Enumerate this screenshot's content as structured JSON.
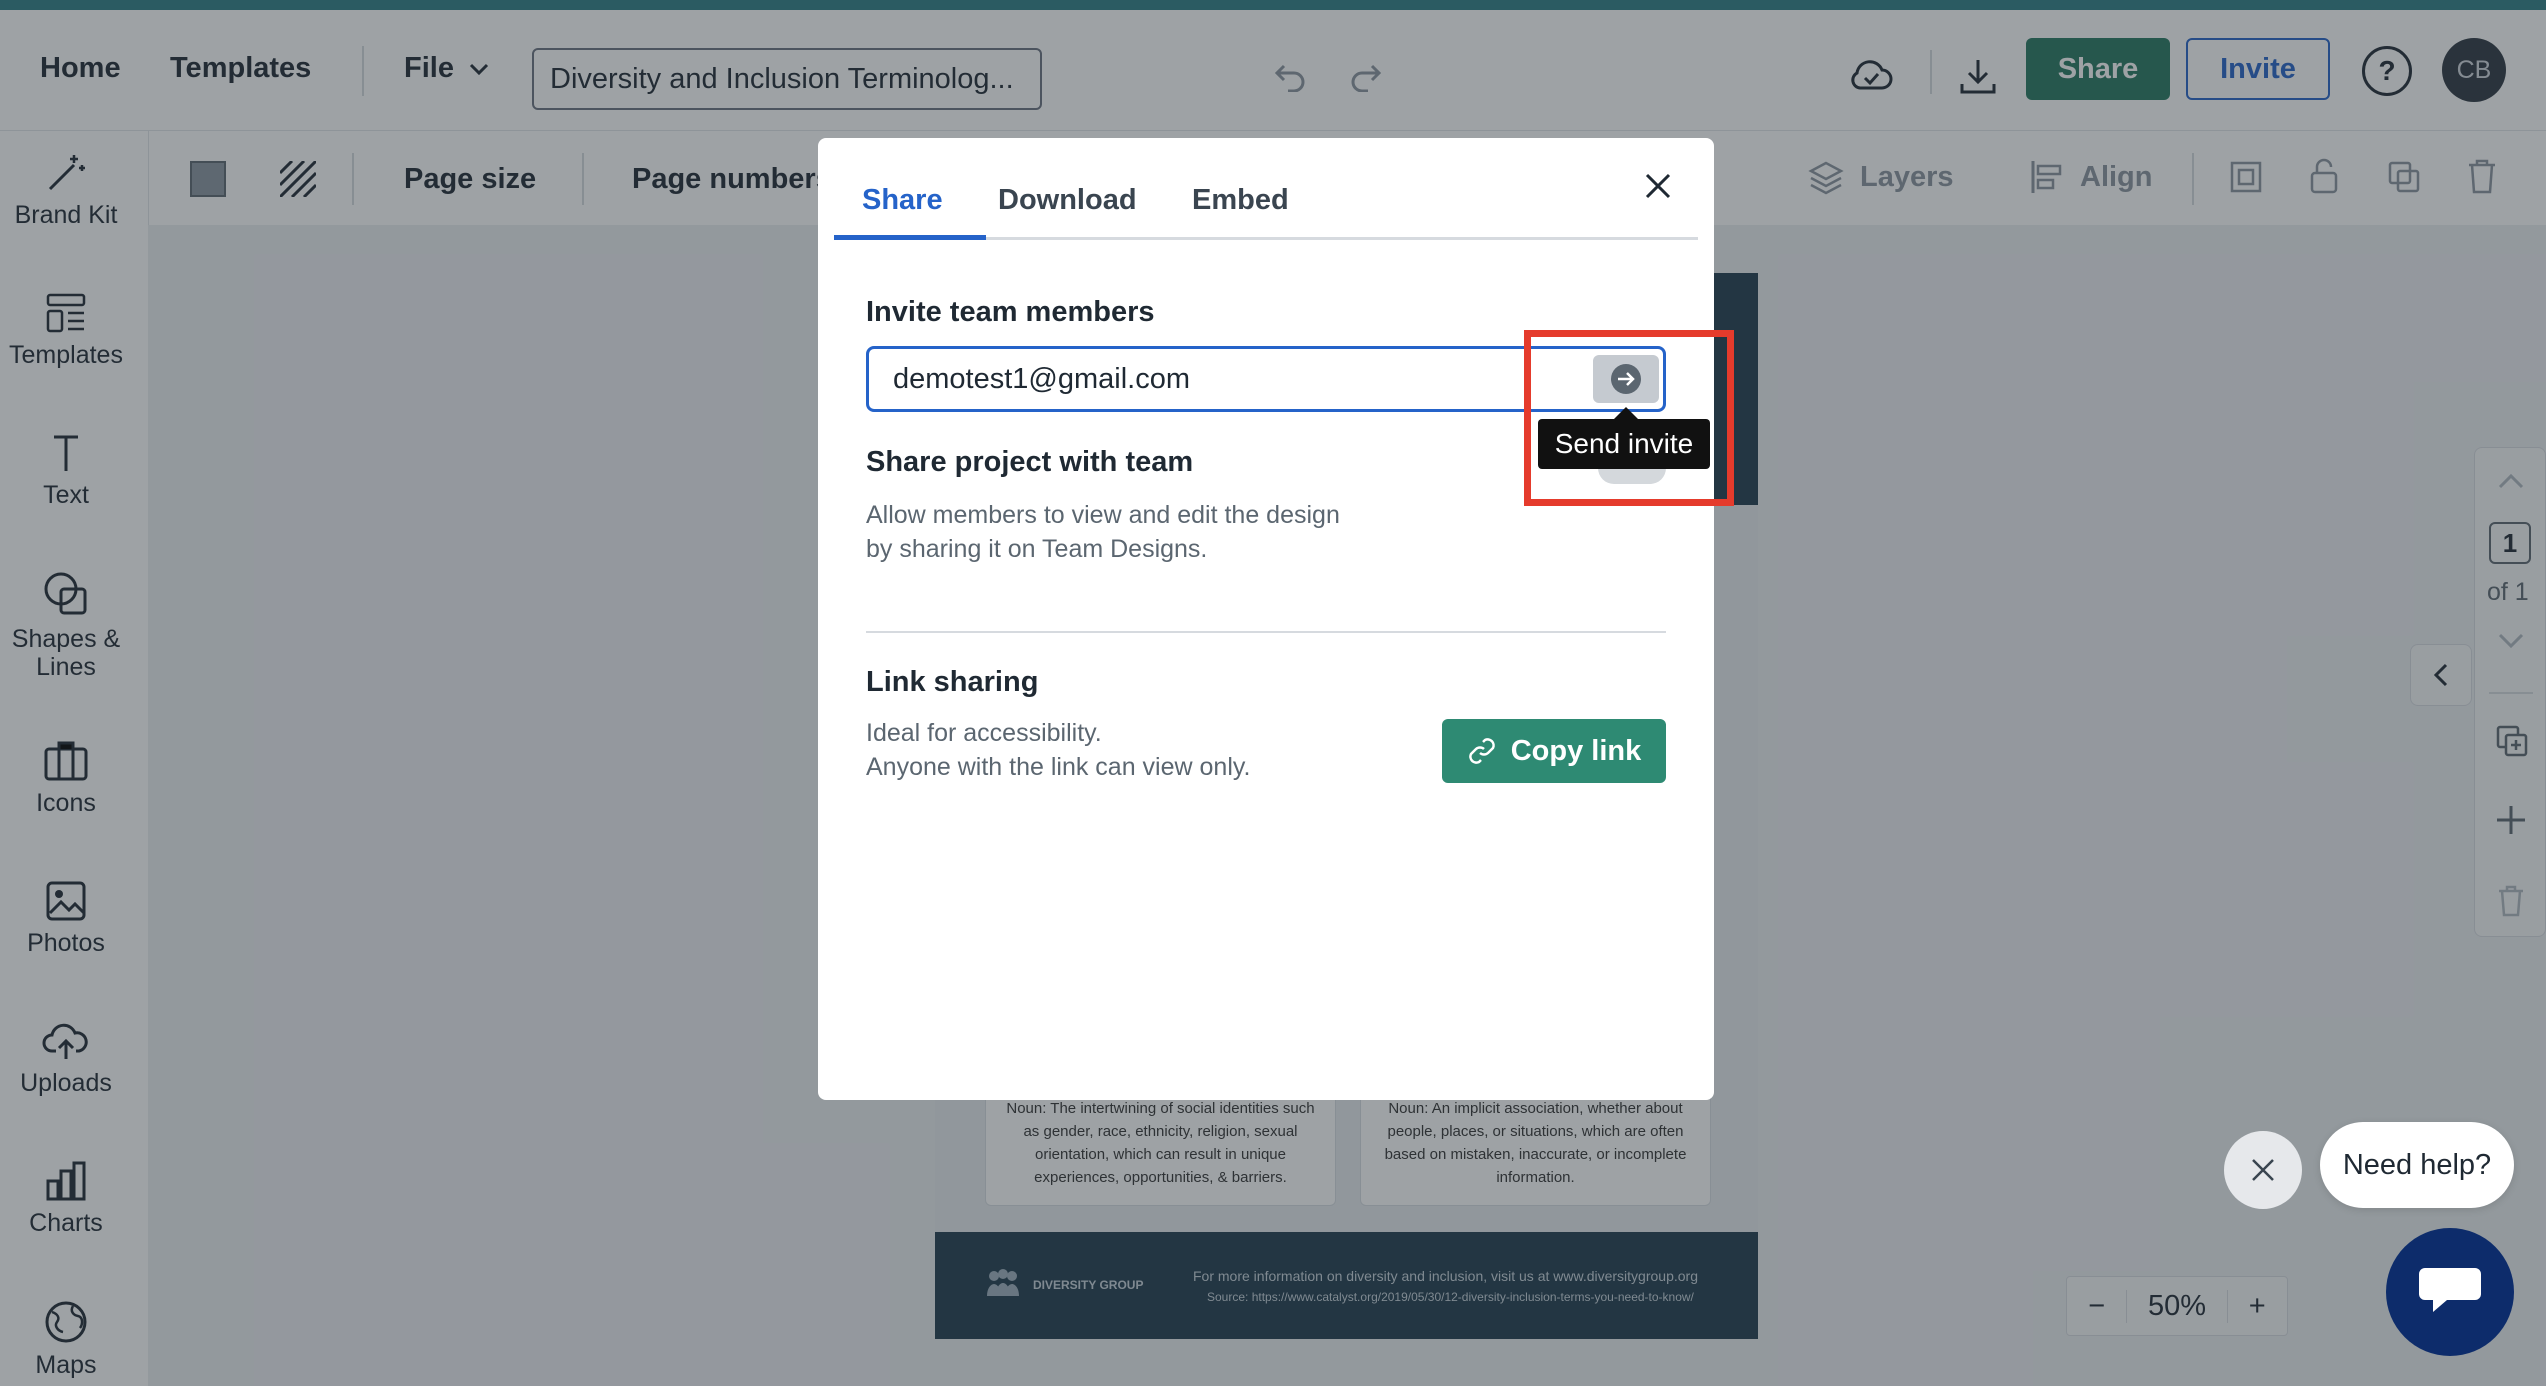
{
  "app": {
    "accent": "#2f7e86",
    "primary": "#2563c9",
    "share_green": "#25775f"
  },
  "topbar": {
    "home": "Home",
    "templates": "Templates",
    "file": "File",
    "doc_name": "Diversity and Inclusion Terminolog...",
    "share": "Share",
    "invite": "Invite",
    "help": "?",
    "avatar": "CB"
  },
  "toolbar": {
    "page_size": "Page size",
    "page_numbers": "Page numbers",
    "layers": "Layers",
    "align": "Align"
  },
  "sidebar": {
    "items": [
      {
        "label": "Brand Kit",
        "icon": "magic-wand-icon"
      },
      {
        "label": "Templates",
        "icon": "templates-icon"
      },
      {
        "label": "Text",
        "icon": "text-icon"
      },
      {
        "label": "Shapes & Lines",
        "icon": "shapes-icon"
      },
      {
        "label": "Icons",
        "icon": "briefcase-icon"
      },
      {
        "label": "Photos",
        "icon": "photo-icon"
      },
      {
        "label": "Uploads",
        "icon": "upload-cloud-icon"
      },
      {
        "label": "Charts",
        "icon": "chart-icon"
      },
      {
        "label": "Maps",
        "icon": "globe-icon"
      }
    ]
  },
  "document": {
    "card_left": "Noun: The intertwining of social identities such as gender, race, ethnicity, religion, sexual orientation, which can result in unique experiences, opportunities, & barriers.",
    "card_right": "Noun: An implicit association, whether about people, places, or situations, which are often based on mistaken, inaccurate, or incomplete information.",
    "footer_brand": "DIVERSITY GROUP",
    "footer_info": "For more information on diversity and inclusion, visit us at www.diversitygroup.org",
    "footer_source": "Source: https://www.catalyst.org/2019/05/30/12-diversity-inclusion-terms-you-need-to-know/"
  },
  "modal": {
    "tabs": [
      "Share",
      "Download",
      "Embed"
    ],
    "active_tab": "Share",
    "invite_heading": "Invite team members",
    "email_value": "demotest1@gmail.com",
    "send_tooltip": "Send invite",
    "share_heading": "Share project with team",
    "share_desc_1": "Allow members to view and edit the design",
    "share_desc_2": "by sharing it on Team Designs.",
    "share_toggle_on": false,
    "link_heading": "Link sharing",
    "link_desc_1": "Ideal for accessibility.",
    "link_desc_2": "Anyone with the link can view only.",
    "copy_link": "Copy link"
  },
  "pages": {
    "current": "1",
    "of": "of 1"
  },
  "zoom": {
    "minus": "−",
    "value": "50%",
    "plus": "+"
  },
  "help": {
    "need_help": "Need help?"
  }
}
